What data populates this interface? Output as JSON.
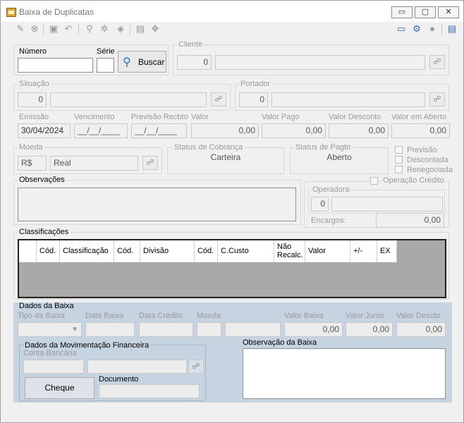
{
  "window": {
    "title": "Baixa de Duplicatas",
    "minimize_label": "▭",
    "maximize_label": "▢",
    "close_label": "✕"
  },
  "toolbar": {
    "left_icons": [
      "edit-icon",
      "cancel-icon",
      "save-icon",
      "undo-icon",
      "search-icon",
      "settings-icon",
      "eraser-icon",
      "print-icon",
      "move-icon"
    ],
    "right_icons": [
      "window-icon",
      "user-search-icon",
      "user-icon",
      "menu-icon"
    ]
  },
  "numero": {
    "label": "Número",
    "value": ""
  },
  "serie": {
    "label": "Série",
    "value": ""
  },
  "buscar_label": "Buscar",
  "cliente": {
    "label": "Cliente",
    "code": "0",
    "name": ""
  },
  "situacao": {
    "label": "Situação",
    "code": "0",
    "name": ""
  },
  "portador": {
    "label": "Portador",
    "code": "0",
    "name": ""
  },
  "dates": {
    "emissao_label": "Emissão",
    "emissao_value": "30/04/2024",
    "vencimento_label": "Vencimento",
    "vencimento_value": "__/__/____",
    "previsao_label": "Previsão Recbto",
    "previsao_value": "__/__/____"
  },
  "amounts": {
    "valor_label": "Valor",
    "valor": "0,00",
    "pago_label": "Valor Pago",
    "pago": "0,00",
    "desconto_label": "Valor Desconto",
    "desconto": "0,00",
    "aberto_label": "Valor em Aberto",
    "aberto": "0,00"
  },
  "moeda": {
    "label": "Moeda",
    "symbol": "R$",
    "name": "Real"
  },
  "status_cobranca": {
    "label": "Status de Cobrança",
    "value": "Carteira"
  },
  "status_pagto": {
    "label": "Status de Pagto",
    "value": "Aberto"
  },
  "checkboxes": {
    "previsao": "Previsão",
    "descontada": "Descontada",
    "renegociada": "Renegociada"
  },
  "observacoes_label": "Observações",
  "operacao_credito": {
    "label": "Operação Crédito",
    "operadora_label": "Operadora",
    "operadora_code": "0",
    "operadora_name": "",
    "encargos_label": "Encargos:",
    "encargos": "0,00"
  },
  "classificacoes": {
    "label": "Classificações",
    "columns": [
      "Cód.",
      "Classificação",
      "Cód.",
      "Divisão",
      "Cód.",
      "C.Custo",
      "Não Recalc.",
      "Valor",
      "+/-",
      "EX"
    ]
  },
  "dados_baixa": {
    "label": "Dados da Baixa",
    "tipo_label": "Tipo da Baixa",
    "data_label": "Data Baixa",
    "credito_label": "Data Crédito",
    "moeda_label": "Moeda",
    "valor_label": "Valor Baixa",
    "valor": "0,00",
    "juros_label": "Valor Juros",
    "juros": "0,00",
    "descto_label": "Valor Descto",
    "descto": "0,00"
  },
  "mov_fin": {
    "label": "Dados da Movimentação Financeira",
    "conta_label": "Conta Bancária",
    "cheque_label": "Cheque",
    "documento_label": "Documento"
  },
  "obs_baixa_label": "Observação da Baixa"
}
